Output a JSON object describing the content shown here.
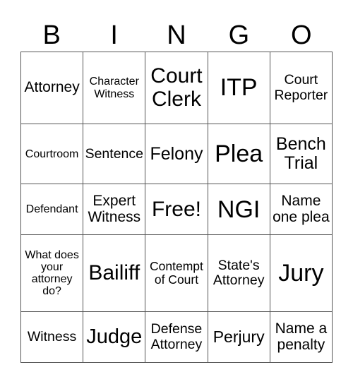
{
  "header": {
    "letters": [
      "B",
      "I",
      "N",
      "G",
      "O"
    ]
  },
  "board": {
    "rows": [
      [
        "Attorney",
        "Character Witness",
        "Court Clerk",
        "ITP",
        "Court Reporter"
      ],
      [
        "Courtroom",
        "Sentence",
        "Felony",
        "Plea",
        "Bench Trial"
      ],
      [
        "Defendant",
        "Expert Witness",
        "Free!",
        "NGI",
        "Name one plea"
      ],
      [
        "What does your attorney do?",
        "Bailiff",
        "Contempt of Court",
        "State's Attorney",
        "Jury"
      ],
      [
        "Witness",
        "Judge",
        "Defense Attorney",
        "Perjury",
        "Name a penalty"
      ]
    ]
  }
}
